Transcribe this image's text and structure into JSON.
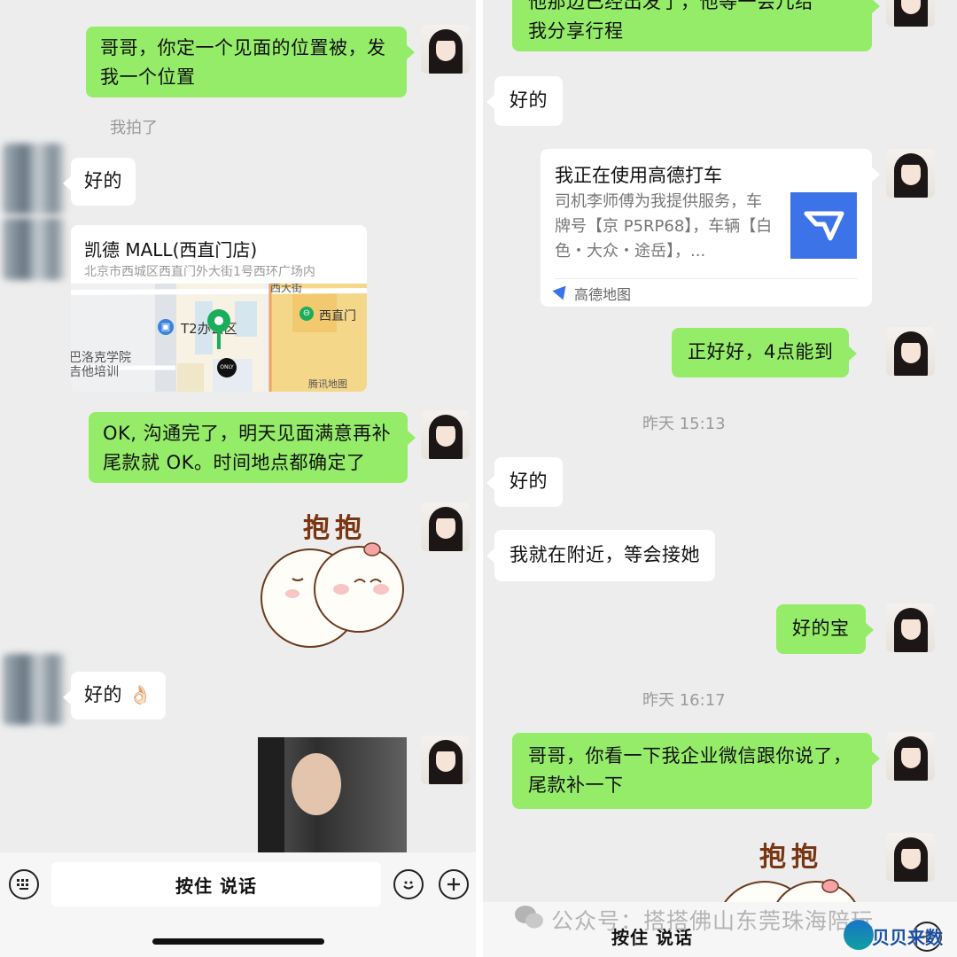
{
  "left": {
    "messages": {
      "m1": "哥哥，你定一个见面的位置被，发我一个位置",
      "system_partial": "我拍了",
      "m2": "好的",
      "m3": "OK, 沟通完了，明天见面满意再补尾款就 OK。时间地点都确定了",
      "sticker": "抱抱",
      "m4": "好的 👌🏻"
    },
    "location": {
      "name": "凯德 MALL(西直门店)",
      "address": "北京市西城区西直门外大街1号西环广场内",
      "map_labels": {
        "top": "西大街",
        "station": "西直门",
        "building": "T2办公区",
        "school": "巴洛克学院\n吉他培训",
        "brand": "ONLY",
        "provider": "腾讯地图"
      }
    },
    "input_bar": {
      "hold_to_talk": "按住 说话"
    }
  },
  "right": {
    "messages": {
      "top_partial_1": "他那边已经出发了，他等一会儿给",
      "top_partial_2": "我分享行程",
      "r1": "好的",
      "r2": "正好好，4点能到",
      "r3": "好的",
      "r4": "我就在附近，等会接她",
      "r5": "好的宝",
      "r6": "哥哥，你看一下我企业微信跟你说了，尾款补一下",
      "sticker": "抱抱"
    },
    "timestamps": [
      "昨天 15:13",
      "昨天 16:17"
    ],
    "taxi_card": {
      "title": "我正在使用高德打车",
      "desc": "司机李师傅为我提供服务，车牌号【京 P5RP68】，车辆【白色・大众・途岳】，...",
      "source": "高德地图"
    },
    "input_bar": {
      "hold_to_talk": "按住 说话"
    }
  },
  "watermark": {
    "text": "公众号：搭搭佛山东莞珠海陪玩",
    "logo_text": "贝贝来数"
  },
  "colors": {
    "chat_bg": "#ededed",
    "sent_bubble": "#95ec69",
    "received_bubble": "#ffffff",
    "map_pin": "#1aad5a",
    "amap_blue": "#3d73e8"
  }
}
